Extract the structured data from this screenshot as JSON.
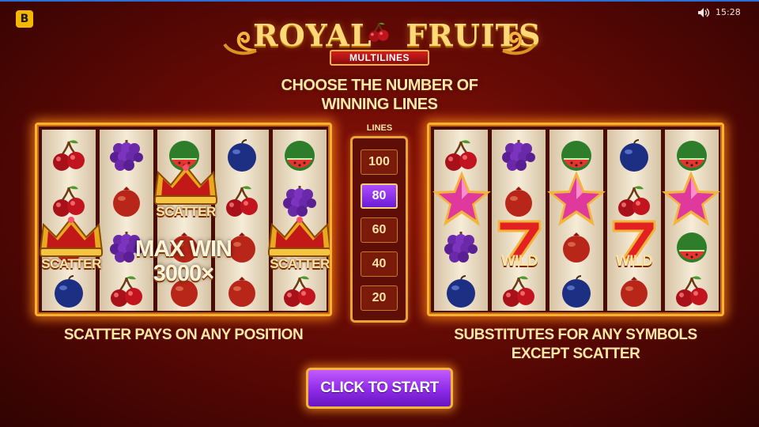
{
  "topbar": {
    "brand_letter": "B",
    "time": "15:28"
  },
  "title": {
    "main_left": "ROYAL",
    "main_right": "FRUITS",
    "subtitle": "MULTILINES"
  },
  "headline": "CHOOSE THE NUMBER OF WINNING LINES",
  "lines_selector": {
    "caption": "LINES",
    "options": [
      "100",
      "80",
      "60",
      "40",
      "20"
    ],
    "selected": "80"
  },
  "left_panel": {
    "scatter_label": "SCATTER",
    "max_win_line1": "MAX WIN",
    "max_win_line2": "3000×",
    "caption": "SCATTER PAYS ON ANY POSITION"
  },
  "right_panel": {
    "wild_label": "WILD",
    "caption_line1": "SUBSTITUTES FOR ANY SYMBOLS",
    "caption_line2": "EXCEPT SCATTER"
  },
  "start_button": {
    "label": "CLICK TO START"
  },
  "colors": {
    "accent_gold": "#ffb030",
    "button_purple": "#8d2ae6",
    "background_red": "#5a0804"
  },
  "icons": [
    "sound-icon",
    "cherry-icon",
    "grapes-icon",
    "plum-icon",
    "watermelon-icon",
    "crown-icon",
    "star-icon",
    "seven-icon"
  ]
}
